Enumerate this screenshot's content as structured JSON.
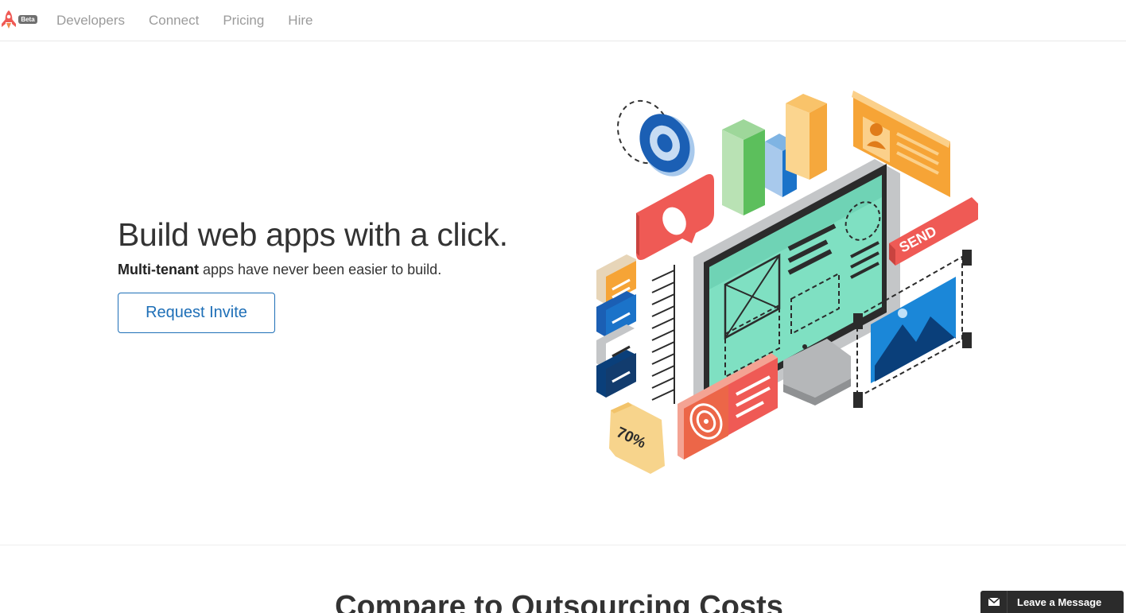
{
  "nav": {
    "beta_label": "Beta",
    "links": [
      {
        "label": "Developers"
      },
      {
        "label": "Connect"
      },
      {
        "label": "Pricing"
      },
      {
        "label": "Hire"
      }
    ]
  },
  "hero": {
    "title": "Build web apps with a click.",
    "subtitle_bold": "Multi-tenant",
    "subtitle_rest": " apps have never been easier to build.",
    "cta_label": "Request Invite",
    "illustration": {
      "percent_label": "70%",
      "send_label": "SEND"
    }
  },
  "section": {
    "title": "Compare to Outsourcing Costs"
  },
  "message_widget": {
    "label": "Leave a Message",
    "icon": "envelope-icon"
  },
  "colors": {
    "accent_blue": "#1e6fb7",
    "brand_red": "#ef5a55",
    "nav_text": "#9b9b9b",
    "widget_bg": "#2b2b2b"
  }
}
